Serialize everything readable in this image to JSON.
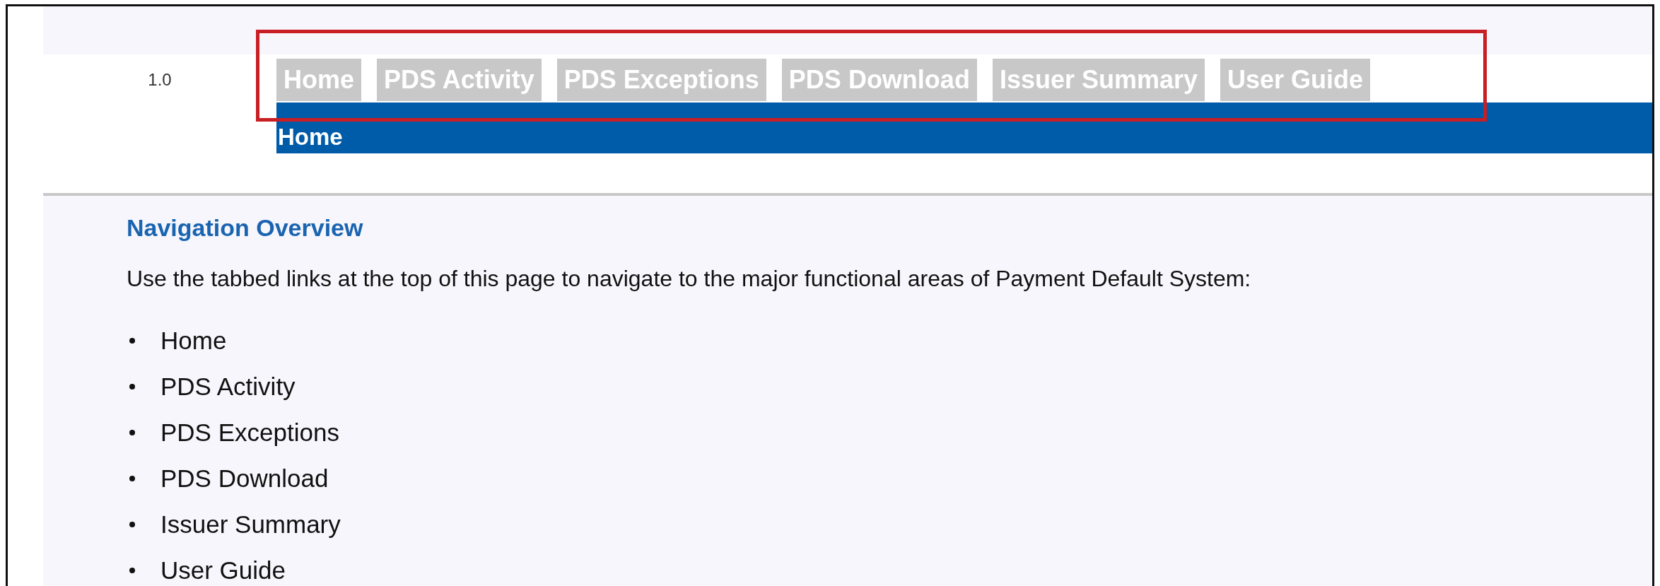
{
  "version": "1.0",
  "tabs": [
    {
      "label": "Home"
    },
    {
      "label": "PDS Activity"
    },
    {
      "label": "PDS Exceptions"
    },
    {
      "label": "PDS Download"
    },
    {
      "label": "Issuer Summary"
    },
    {
      "label": "User Guide"
    }
  ],
  "page_title": "Home",
  "heading": "Navigation Overview",
  "intro": "Use the tabbed links at the top of this page to navigate to the major functional areas of Payment Default System:",
  "list_items": [
    "Home",
    "PDS Activity",
    "PDS Exceptions",
    "PDS Download",
    "Issuer Summary",
    "User Guide"
  ]
}
